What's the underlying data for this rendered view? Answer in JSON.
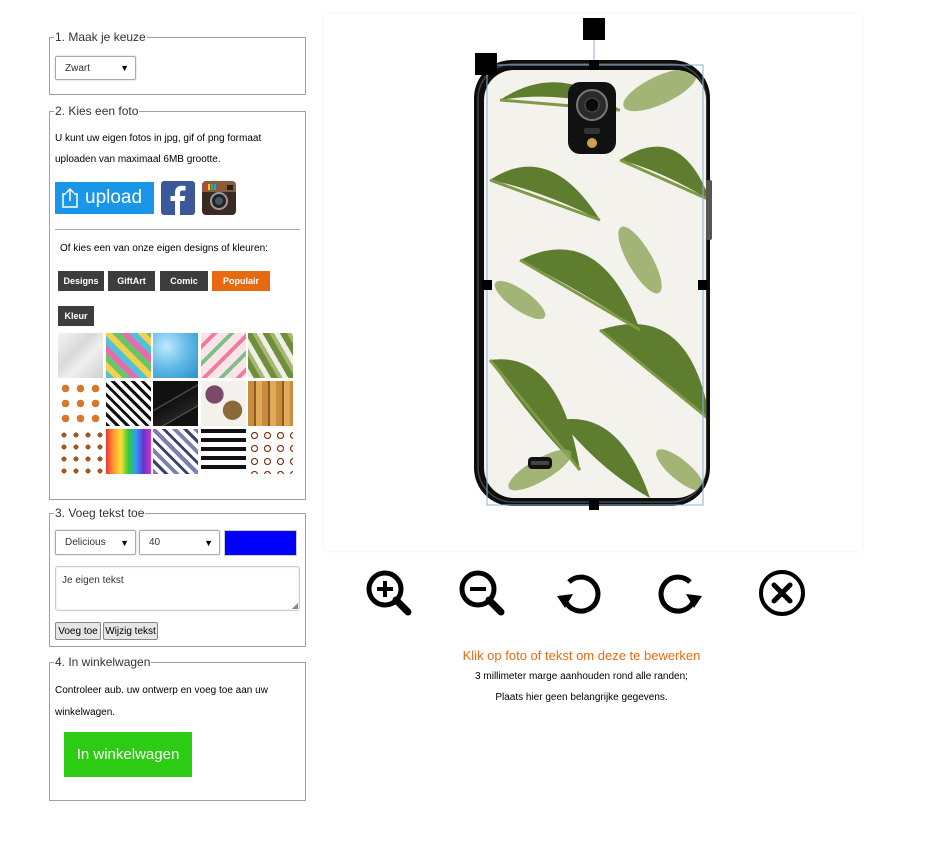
{
  "step1": {
    "legend": "1. Maak je keuze",
    "color_value": "Zwart"
  },
  "step2": {
    "legend": "2. Kies een foto",
    "intro_line1": "U kunt uw eigen fotos in jpg, gif of png formaat",
    "intro_line2": "uploaden van maximaal 6MB grootte.",
    "upload_label": "upload",
    "designs_intro": "Of kies een van onze eigen designs of kleuren:",
    "tabs": [
      "Designs",
      "GiftArt",
      "Comic",
      "Populair",
      "Kleur"
    ],
    "active_tab": "Populair",
    "tiles": [
      "marble",
      "pineapples",
      "blue-glitter",
      "flamingos",
      "palm-leaves",
      "croissants",
      "chevron",
      "black-marble",
      "autumn-leaves",
      "bamboo",
      "birds",
      "paint-drips",
      "herringbone",
      "brush-stripes",
      "animal-print"
    ]
  },
  "step3": {
    "legend": "3. Voeg tekst toe",
    "font_value": "Delicious",
    "size_value": "40",
    "text_color": "#0000ff",
    "text_placeholder": "Je eigen tekst",
    "add_label": "Voeg toe",
    "edit_label": "Wijzig tekst"
  },
  "step4": {
    "legend": "4. In winkelwagen",
    "line1": "Controleer aub. uw ontwerp en voeg toe aan uw",
    "line2": "winkelwagen.",
    "cart_label": "In winkelwagen"
  },
  "preview": {
    "hint": "Klik op foto of tekst om deze te bewerken",
    "note_line1": "3 millimeter marge aanhouden rond alle randen;",
    "note_line2": "Plaats hier geen belangrijke gegevens."
  },
  "controls": [
    "zoom-in-icon",
    "zoom-out-icon",
    "rotate-left-icon",
    "rotate-right-icon",
    "delete-icon"
  ],
  "colors": {
    "accent_orange": "#e86a10",
    "cart_green": "#2ccc14",
    "upload_blue": "#1a96e8",
    "tab_dark": "#3d3d3d"
  }
}
